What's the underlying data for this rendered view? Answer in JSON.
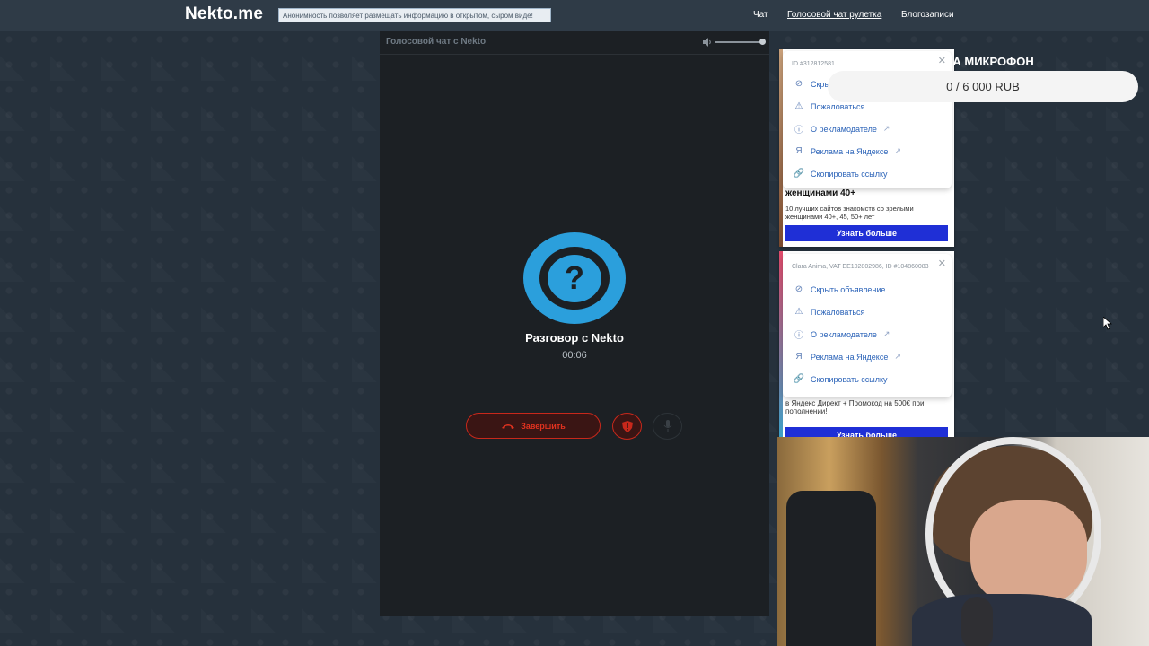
{
  "header": {
    "logo": "Nekto.me",
    "tagline": "Анонимность позволяет размещать информацию в открытом, сыром виде!",
    "nav": [
      "Чат",
      "Голосовой чат рулетка",
      "Блогозаписи"
    ]
  },
  "call": {
    "panel_title": "Голосовой чат с Nekto",
    "avatar_symbol": "?",
    "name": "Разговор с Nekto",
    "timer": "00:06",
    "end_label": "Завершить"
  },
  "ads": [
    {
      "id_text": "ID #312812581",
      "menu": [
        "Скрыть объявление",
        "Пожаловаться",
        "О рекламодателе",
        "Реклама на Яндексе",
        "Скопировать ссылку"
      ],
      "headline": "женщинами 40+",
      "text": "10 лучших сайтов знакомств со зрелыми женщинами 40+, 45, 50+ лет",
      "cta": "Узнать больше"
    },
    {
      "id_text": "Clara Anima, VAT EE102802986, ID #104860083",
      "menu": [
        "Скрыть объявление",
        "Пожаловаться",
        "О рекламодателе",
        "Реклама на Яндексе",
        "Скопировать ссылку"
      ],
      "text": "в Яндекс Директ + Промокод на 500€ при пополнении!",
      "cta": "Узнать больше"
    }
  ],
  "donation": {
    "title": "НА МИКРОФОН",
    "progress_text": "0 / 6 000 RUB",
    "progress_fraction": 0
  },
  "colors": {
    "accent": "#2b9fdc",
    "danger": "#c8281b",
    "ad_cta": "#1f2fd6"
  }
}
